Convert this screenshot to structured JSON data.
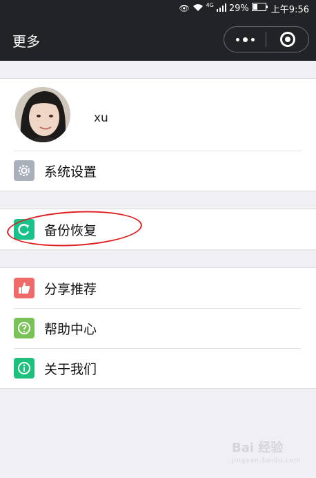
{
  "status_bar": {
    "network": "4G",
    "battery": "29%",
    "time": "上午9:56"
  },
  "nav": {
    "title": "更多"
  },
  "profile": {
    "username": "xu"
  },
  "menu": {
    "settings": {
      "label": "系统设置",
      "icon": "gear-icon",
      "color": "#a9b0bb"
    },
    "backup": {
      "label": "备份恢复",
      "icon": "refresh-icon",
      "color": "#19c18b"
    },
    "share": {
      "label": "分享推荐",
      "icon": "thumbs-up-icon",
      "color": "#f06a6a"
    },
    "help": {
      "label": "帮助中心",
      "icon": "question-icon",
      "color": "#79c257"
    },
    "about": {
      "label": "关于我们",
      "icon": "info-icon",
      "color": "#1ec07e"
    }
  },
  "annotation": {
    "highlight_color": "#e02020"
  },
  "watermark": {
    "text": "Bai 经验",
    "sub": "jingyan.baidu.com"
  }
}
